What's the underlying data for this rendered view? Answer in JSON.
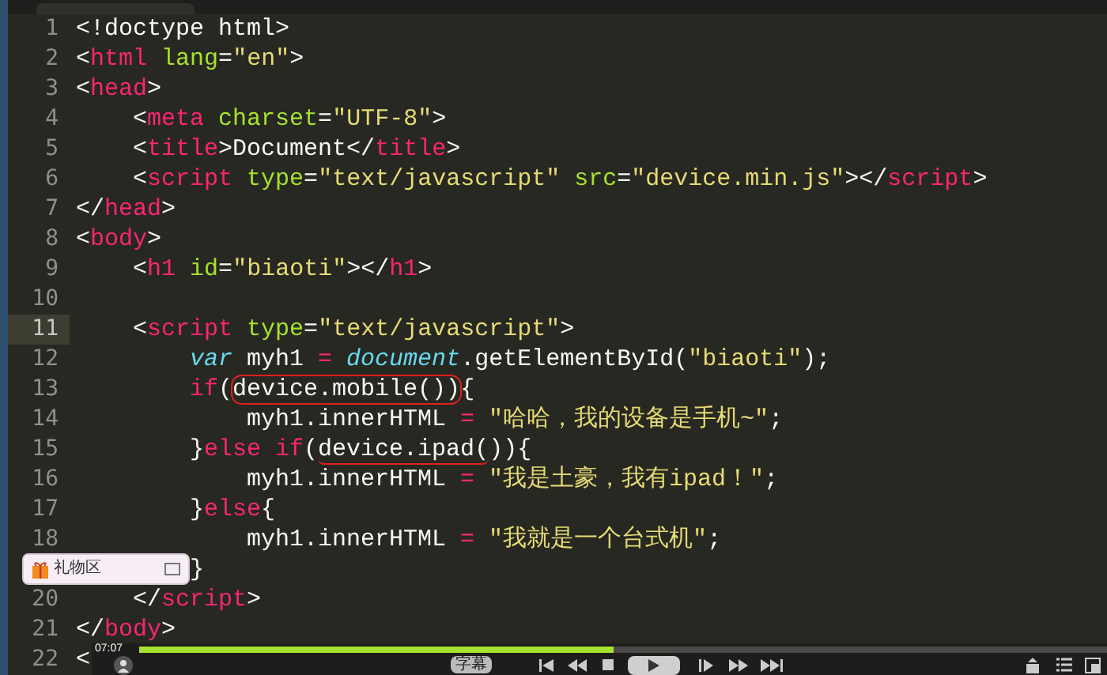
{
  "editor": {
    "lines": [
      {
        "number": "1",
        "current": false,
        "tokens": [
          {
            "kind": "plain",
            "text": "<!doctype html>"
          }
        ]
      },
      {
        "number": "2",
        "current": false,
        "tokens": [
          {
            "kind": "plain",
            "text": "<"
          },
          {
            "kind": "tag",
            "text": "html"
          },
          {
            "kind": "attr",
            "text": " lang"
          },
          {
            "kind": "plain",
            "text": "="
          },
          {
            "kind": "string",
            "text": "\"en\""
          },
          {
            "kind": "plain",
            "text": ">"
          }
        ]
      },
      {
        "number": "3",
        "current": false,
        "tokens": [
          {
            "kind": "plain",
            "text": "<"
          },
          {
            "kind": "tag",
            "text": "head"
          },
          {
            "kind": "plain",
            "text": ">"
          }
        ]
      },
      {
        "number": "4",
        "current": false,
        "tokens": [
          {
            "kind": "plain",
            "text": "    <"
          },
          {
            "kind": "tag",
            "text": "meta"
          },
          {
            "kind": "attr",
            "text": " charset"
          },
          {
            "kind": "plain",
            "text": "="
          },
          {
            "kind": "string",
            "text": "\"UTF-8\""
          },
          {
            "kind": "plain",
            "text": ">"
          }
        ]
      },
      {
        "number": "5",
        "current": false,
        "tokens": [
          {
            "kind": "plain",
            "text": "    <"
          },
          {
            "kind": "tag",
            "text": "title"
          },
          {
            "kind": "plain",
            "text": ">Document</"
          },
          {
            "kind": "tag",
            "text": "title"
          },
          {
            "kind": "plain",
            "text": ">"
          }
        ]
      },
      {
        "number": "6",
        "current": false,
        "tokens": [
          {
            "kind": "plain",
            "text": "    <"
          },
          {
            "kind": "tag",
            "text": "script"
          },
          {
            "kind": "attr",
            "text": " type"
          },
          {
            "kind": "plain",
            "text": "="
          },
          {
            "kind": "string",
            "text": "\"text/javascript\""
          },
          {
            "kind": "attr",
            "text": " src"
          },
          {
            "kind": "plain",
            "text": "="
          },
          {
            "kind": "string",
            "text": "\"device.min.js\""
          },
          {
            "kind": "plain",
            "text": "></"
          },
          {
            "kind": "tag",
            "text": "script"
          },
          {
            "kind": "plain",
            "text": ">"
          }
        ]
      },
      {
        "number": "7",
        "current": false,
        "tokens": [
          {
            "kind": "plain",
            "text": "</"
          },
          {
            "kind": "tag",
            "text": "head"
          },
          {
            "kind": "plain",
            "text": ">"
          }
        ]
      },
      {
        "number": "8",
        "current": false,
        "tokens": [
          {
            "kind": "plain",
            "text": "<"
          },
          {
            "kind": "tag",
            "text": "body"
          },
          {
            "kind": "plain",
            "text": ">"
          }
        ]
      },
      {
        "number": "9",
        "current": false,
        "tokens": [
          {
            "kind": "plain",
            "text": "    <"
          },
          {
            "kind": "tag",
            "text": "h1"
          },
          {
            "kind": "attr",
            "text": " id"
          },
          {
            "kind": "plain",
            "text": "="
          },
          {
            "kind": "string",
            "text": "\"biaoti\""
          },
          {
            "kind": "plain",
            "text": "></"
          },
          {
            "kind": "tag",
            "text": "h1"
          },
          {
            "kind": "plain",
            "text": ">"
          }
        ]
      },
      {
        "number": "10",
        "current": false
      },
      {
        "number": "11",
        "current": true,
        "tokens": [
          {
            "kind": "plain",
            "text": "    <"
          },
          {
            "kind": "tag",
            "text": "script"
          },
          {
            "kind": "attr",
            "text": " type"
          },
          {
            "kind": "plain",
            "text": "="
          },
          {
            "kind": "string",
            "text": "\"text/javascript\""
          },
          {
            "kind": "plain",
            "text": ">"
          }
        ]
      },
      {
        "number": "12",
        "current": false,
        "tokens": [
          {
            "kind": "builtin",
            "text": "        var"
          },
          {
            "kind": "plain",
            "text": " myh1 "
          },
          {
            "kind": "keyword",
            "text": "="
          },
          {
            "kind": "builtin",
            "text": " document"
          },
          {
            "kind": "plain",
            "text": ".getElementById("
          },
          {
            "kind": "string",
            "text": "\"biaoti\""
          },
          {
            "kind": "plain",
            "text": ");"
          }
        ]
      },
      {
        "number": "13",
        "current": false,
        "tokens": [
          {
            "kind": "keyword",
            "text": "        if"
          },
          {
            "kind": "plain",
            "text": "("
          },
          {
            "kind": "circled",
            "text": "device.mobile())"
          },
          {
            "kind": "plain",
            "text": "{"
          }
        ]
      },
      {
        "number": "14",
        "current": false,
        "tokens": [
          {
            "kind": "plain",
            "text": "            myh1.innerHTML "
          },
          {
            "kind": "keyword",
            "text": "="
          },
          {
            "kind": "string",
            "text": " \"哈哈，我的设备是手机~\""
          },
          {
            "kind": "plain",
            "text": ";"
          }
        ]
      },
      {
        "number": "15",
        "current": false,
        "tokens": [
          {
            "kind": "plain",
            "text": "        }"
          },
          {
            "kind": "keyword",
            "text": "else if"
          },
          {
            "kind": "plain",
            "text": "("
          },
          {
            "kind": "underlined",
            "text": "device.ipad("
          },
          {
            "kind": "plain",
            "text": ")){"
          }
        ]
      },
      {
        "number": "16",
        "current": false,
        "tokens": [
          {
            "kind": "plain",
            "text": "            myh1.innerHTML "
          },
          {
            "kind": "keyword",
            "text": "="
          },
          {
            "kind": "string",
            "text": " \"我是土豪，我有ipad！\""
          },
          {
            "kind": "plain",
            "text": ";"
          }
        ]
      },
      {
        "number": "17",
        "current": false,
        "tokens": [
          {
            "kind": "plain",
            "text": "        }"
          },
          {
            "kind": "keyword",
            "text": "else"
          },
          {
            "kind": "plain",
            "text": "{"
          }
        ]
      },
      {
        "number": "18",
        "current": false,
        "tokens": [
          {
            "kind": "plain",
            "text": "            myh1.innerHTML "
          },
          {
            "kind": "keyword",
            "text": "="
          },
          {
            "kind": "string",
            "text": " \"我就是一个台式机\""
          },
          {
            "kind": "plain",
            "text": ";"
          }
        ]
      },
      {
        "current": false,
        "tokens": [
          {
            "kind": "plain",
            "text": "        }"
          }
        ]
      },
      {
        "number": "20",
        "current": false,
        "tokens": [
          {
            "kind": "plain",
            "text": "    </"
          },
          {
            "kind": "tag",
            "text": "script"
          },
          {
            "kind": "plain",
            "text": ">"
          }
        ]
      },
      {
        "number": "21",
        "current": false,
        "tokens": [
          {
            "kind": "plain",
            "text": "</"
          },
          {
            "kind": "tag",
            "text": "body"
          },
          {
            "kind": "plain",
            "text": ">"
          }
        ]
      },
      {
        "number": "22",
        "current": false,
        "tokens": [
          {
            "kind": "plain",
            "text": "<"
          }
        ]
      }
    ]
  },
  "gift_panel": {
    "label": "礼物区"
  },
  "player": {
    "time": "07:07",
    "progress": {
      "level": 0.49
    },
    "subtitle_button": "字幕"
  }
}
